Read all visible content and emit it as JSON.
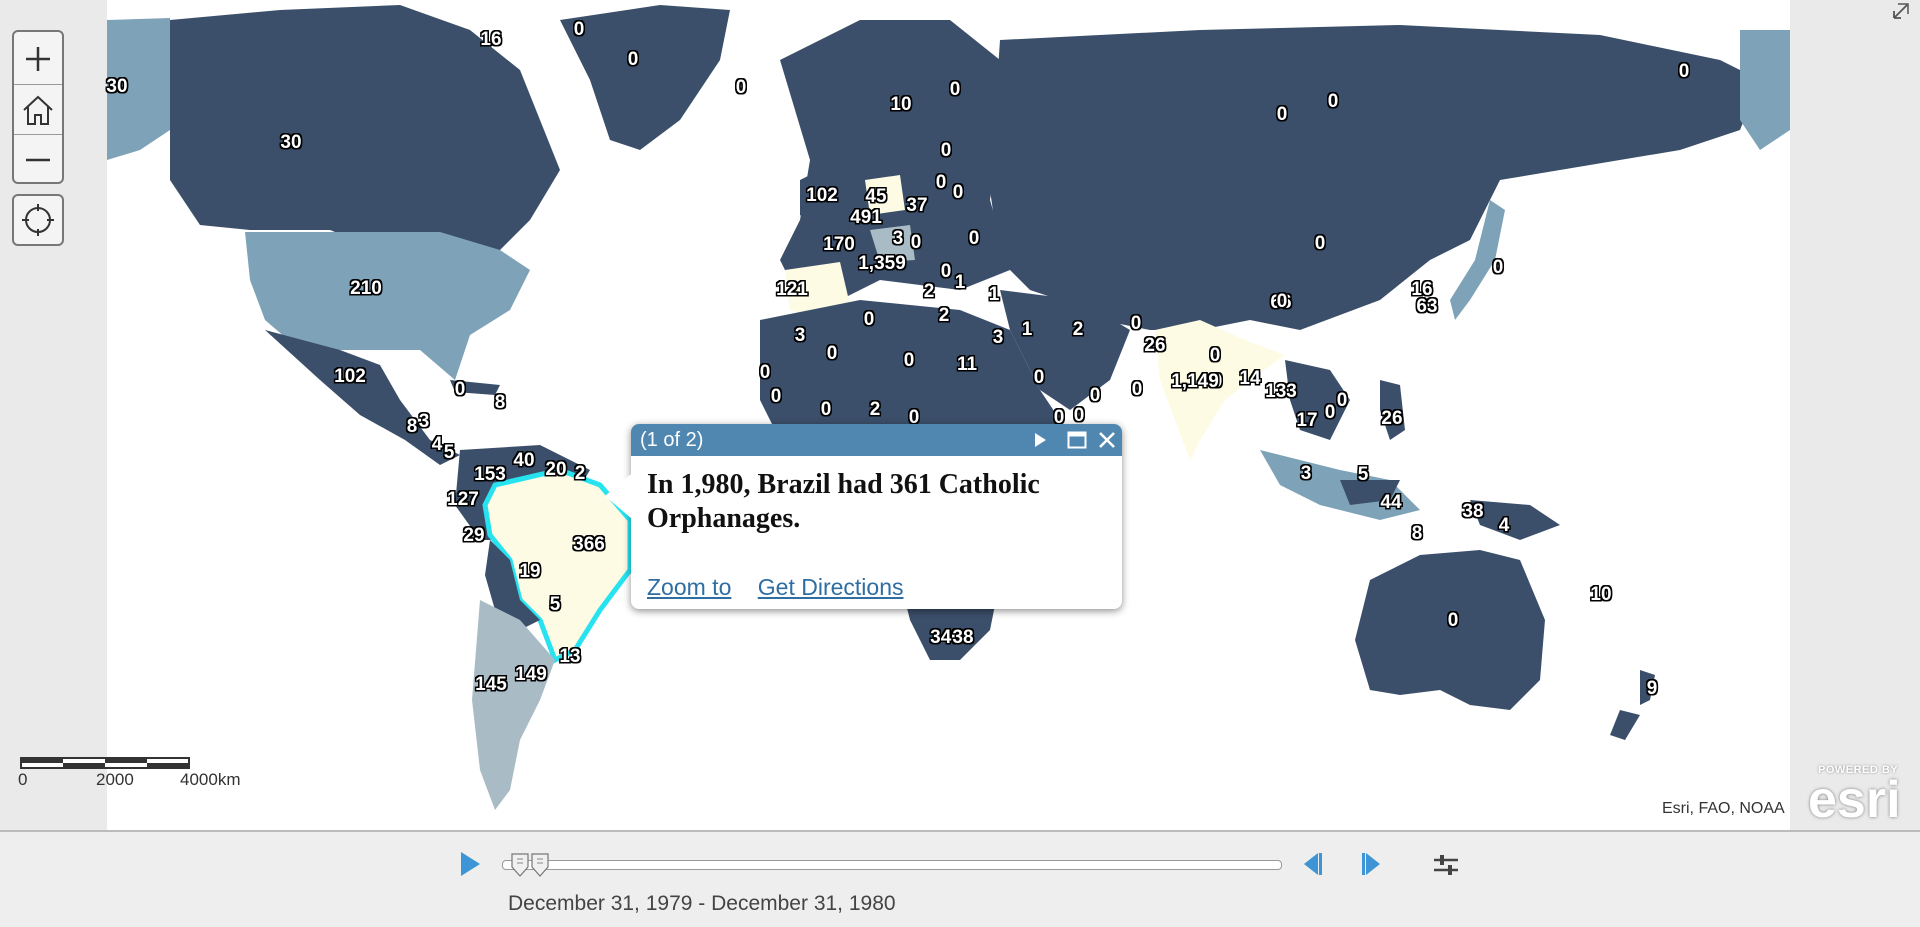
{
  "map": {
    "attribution": "Esri, FAO, NOAA",
    "logo": {
      "small": "POWERED BY",
      "big": "esri"
    },
    "scalebar": {
      "ticks": [
        "0",
        "2000",
        "4000km"
      ]
    },
    "colors": {
      "ocean": "#ffffff",
      "class_low": "#3b4f6a",
      "class_mid": "#7ea3b8",
      "class_light": "#a9bcc6",
      "class_high": "#fdfbe3",
      "selected_outline": "#27e3f0"
    },
    "labels": [
      {
        "text": "0"
      },
      {
        "text": "16"
      },
      {
        "text": "0"
      },
      {
        "text": "0"
      },
      {
        "text": "30"
      },
      {
        "text": "30"
      },
      {
        "text": "210"
      },
      {
        "text": "102"
      },
      {
        "text": "0"
      },
      {
        "text": "8"
      },
      {
        "text": "8"
      },
      {
        "text": "3"
      },
      {
        "text": "4"
      },
      {
        "text": "5"
      },
      {
        "text": "153"
      },
      {
        "text": "40"
      },
      {
        "text": "20"
      },
      {
        "text": "2"
      },
      {
        "text": "127"
      },
      {
        "text": "29"
      },
      {
        "text": "366"
      },
      {
        "text": "19"
      },
      {
        "text": "5"
      },
      {
        "text": "13"
      },
      {
        "text": "145"
      },
      {
        "text": "149"
      },
      {
        "text": "10"
      },
      {
        "text": "0"
      },
      {
        "text": "0"
      },
      {
        "text": "0"
      },
      {
        "text": "45"
      },
      {
        "text": "102"
      },
      {
        "text": "37"
      },
      {
        "text": "0"
      },
      {
        "text": "491"
      },
      {
        "text": "3"
      },
      {
        "text": "0"
      },
      {
        "text": "0"
      },
      {
        "text": "170"
      },
      {
        "text": "1,359"
      },
      {
        "text": "0"
      },
      {
        "text": "1"
      },
      {
        "text": "121"
      },
      {
        "text": "2"
      },
      {
        "text": "1"
      },
      {
        "text": "2"
      },
      {
        "text": "3"
      },
      {
        "text": "0"
      },
      {
        "text": "0"
      },
      {
        "text": "0"
      },
      {
        "text": "11"
      },
      {
        "text": "3"
      },
      {
        "text": "1"
      },
      {
        "text": "2"
      },
      {
        "text": "0"
      },
      {
        "text": "0"
      },
      {
        "text": "0"
      },
      {
        "text": "0"
      },
      {
        "text": "0"
      },
      {
        "text": "2"
      },
      {
        "text": "0"
      },
      {
        "text": "0"
      },
      {
        "text": "0"
      },
      {
        "text": "0"
      },
      {
        "text": "0"
      },
      {
        "text": "0"
      },
      {
        "text": "26"
      },
      {
        "text": "0"
      },
      {
        "text": "1,149"
      },
      {
        "text": "14"
      },
      {
        "text": "133"
      },
      {
        "text": "0"
      },
      {
        "text": "17"
      },
      {
        "text": "0"
      },
      {
        "text": "26"
      },
      {
        "text": "3"
      },
      {
        "text": "5"
      },
      {
        "text": "44"
      },
      {
        "text": "8"
      },
      {
        "text": "38"
      },
      {
        "text": "4"
      },
      {
        "text": "0"
      },
      {
        "text": "0"
      },
      {
        "text": "0"
      },
      {
        "text": "0"
      },
      {
        "text": "16"
      },
      {
        "text": "66"
      },
      {
        "text": "63"
      },
      {
        "text": "0"
      },
      {
        "text": "0"
      },
      {
        "text": "340"
      },
      {
        "text": "38"
      },
      {
        "text": "0"
      },
      {
        "text": "10"
      },
      {
        "text": "9"
      }
    ]
  },
  "popup": {
    "count": "(1 of 2)",
    "body": "In 1,980, Brazil had 361 Catholic Orphanages.",
    "links": {
      "zoom": "Zoom to",
      "directions": "Get Directions"
    }
  },
  "timeslider": {
    "range_text": "December 31, 1979 - December 31, 1980",
    "position": 0.03
  }
}
